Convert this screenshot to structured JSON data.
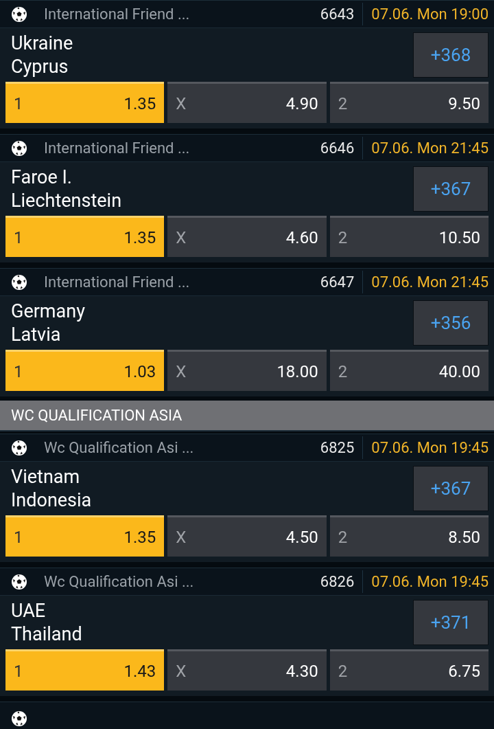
{
  "items": [
    {
      "kind": "match",
      "league": "International Friend ...",
      "code": "6643",
      "time": "07.06. Mon 19:00",
      "home": "Ukraine",
      "away": "Cyprus",
      "more": "+368",
      "odds": [
        {
          "label": "1",
          "value": "1.35",
          "selected": true
        },
        {
          "label": "X",
          "value": "4.90",
          "selected": false
        },
        {
          "label": "2",
          "value": "9.50",
          "selected": false
        }
      ]
    },
    {
      "kind": "match",
      "league": "International Friend ...",
      "code": "6646",
      "time": "07.06. Mon 21:45",
      "home": "Faroe I.",
      "away": "Liechtenstein",
      "more": "+367",
      "odds": [
        {
          "label": "1",
          "value": "1.35",
          "selected": true
        },
        {
          "label": "X",
          "value": "4.60",
          "selected": false
        },
        {
          "label": "2",
          "value": "10.50",
          "selected": false
        }
      ]
    },
    {
      "kind": "match",
      "league": "International Friend ...",
      "code": "6647",
      "time": "07.06. Mon 21:45",
      "home": "Germany",
      "away": "Latvia",
      "more": "+356",
      "odds": [
        {
          "label": "1",
          "value": "1.03",
          "selected": true
        },
        {
          "label": "X",
          "value": "18.00",
          "selected": false
        },
        {
          "label": "2",
          "value": "40.00",
          "selected": false
        }
      ]
    },
    {
      "kind": "section",
      "title": "WC QUALIFICATION ASIA"
    },
    {
      "kind": "match",
      "league": "Wc Qualification Asi ...",
      "code": "6825",
      "time": "07.06. Mon 19:45",
      "home": "Vietnam",
      "away": "Indonesia",
      "more": "+367",
      "odds": [
        {
          "label": "1",
          "value": "1.35",
          "selected": true
        },
        {
          "label": "X",
          "value": "4.50",
          "selected": false
        },
        {
          "label": "2",
          "value": "8.50",
          "selected": false
        }
      ]
    },
    {
      "kind": "match",
      "league": "Wc Qualification Asi ...",
      "code": "6826",
      "time": "07.06. Mon 19:45",
      "home": "UAE",
      "away": "Thailand",
      "more": "+371",
      "odds": [
        {
          "label": "1",
          "value": "1.43",
          "selected": true
        },
        {
          "label": "X",
          "value": "4.30",
          "selected": false
        },
        {
          "label": "2",
          "value": "6.75",
          "selected": false
        }
      ]
    },
    {
      "kind": "partial"
    }
  ]
}
